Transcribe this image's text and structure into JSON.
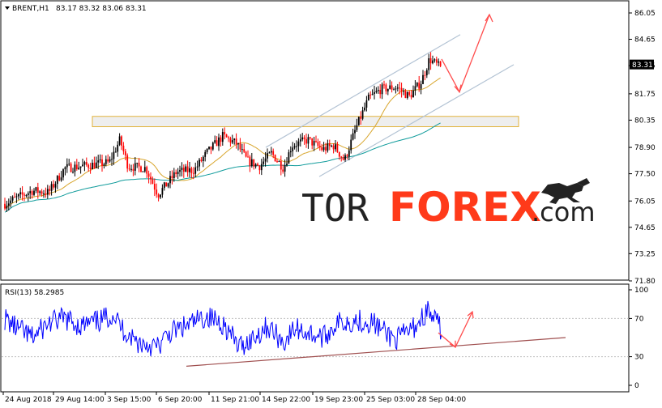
{
  "chart_data": [
    {
      "type": "candlestick",
      "symbol_label": "BRENT,H1",
      "ohlc_label": "83.17 83.32 83.06 83.31",
      "current_price": "83.31",
      "y_ticks": [
        "86.05",
        "84.65",
        "83.25",
        "81.75",
        "80.35",
        "78.90",
        "77.50",
        "76.05",
        "74.65",
        "73.25",
        "71.80"
      ],
      "ylim": [
        71.8,
        86.05
      ],
      "resistance_zone": [
        80.0,
        80.55
      ],
      "forecast_path": [
        83.6,
        81.85,
        86.05
      ],
      "colors": {
        "up": "#000000",
        "down": "#ff0000",
        "ma_fast": "#d8a62d",
        "ma_slow": "#0f9b9b",
        "channel": "#b3c3d4",
        "zone_fill": "#eeeeee",
        "zone_border": "#e2b23a",
        "arrow": "#ff4d4d",
        "current_price_box": "#000000"
      }
    },
    {
      "type": "line",
      "indicator_label": "RSI(13) 58.2985",
      "y_ticks": [
        "100",
        "70",
        "30",
        "0"
      ],
      "ylim": [
        0,
        100
      ],
      "levels": [
        30,
        70
      ],
      "series_color": "#0000ff",
      "trendline_color": "#a05050"
    }
  ],
  "x_ticks": [
    "24 Aug 2018",
    "29 Aug 14:00",
    "3 Sep 15:00",
    "6 Sep 20:00",
    "11 Sep 21:00",
    "14 Sep 22:00",
    "19 Sep 23:00",
    "25 Sep 03:00",
    "28 Sep 04:00"
  ],
  "watermark": {
    "part1": "TOR",
    "part2": "FOREX",
    ".com": ".com"
  },
  "watermark_text": {
    "tor": "TOR",
    "forex": "FOREX",
    "com": ".com"
  }
}
